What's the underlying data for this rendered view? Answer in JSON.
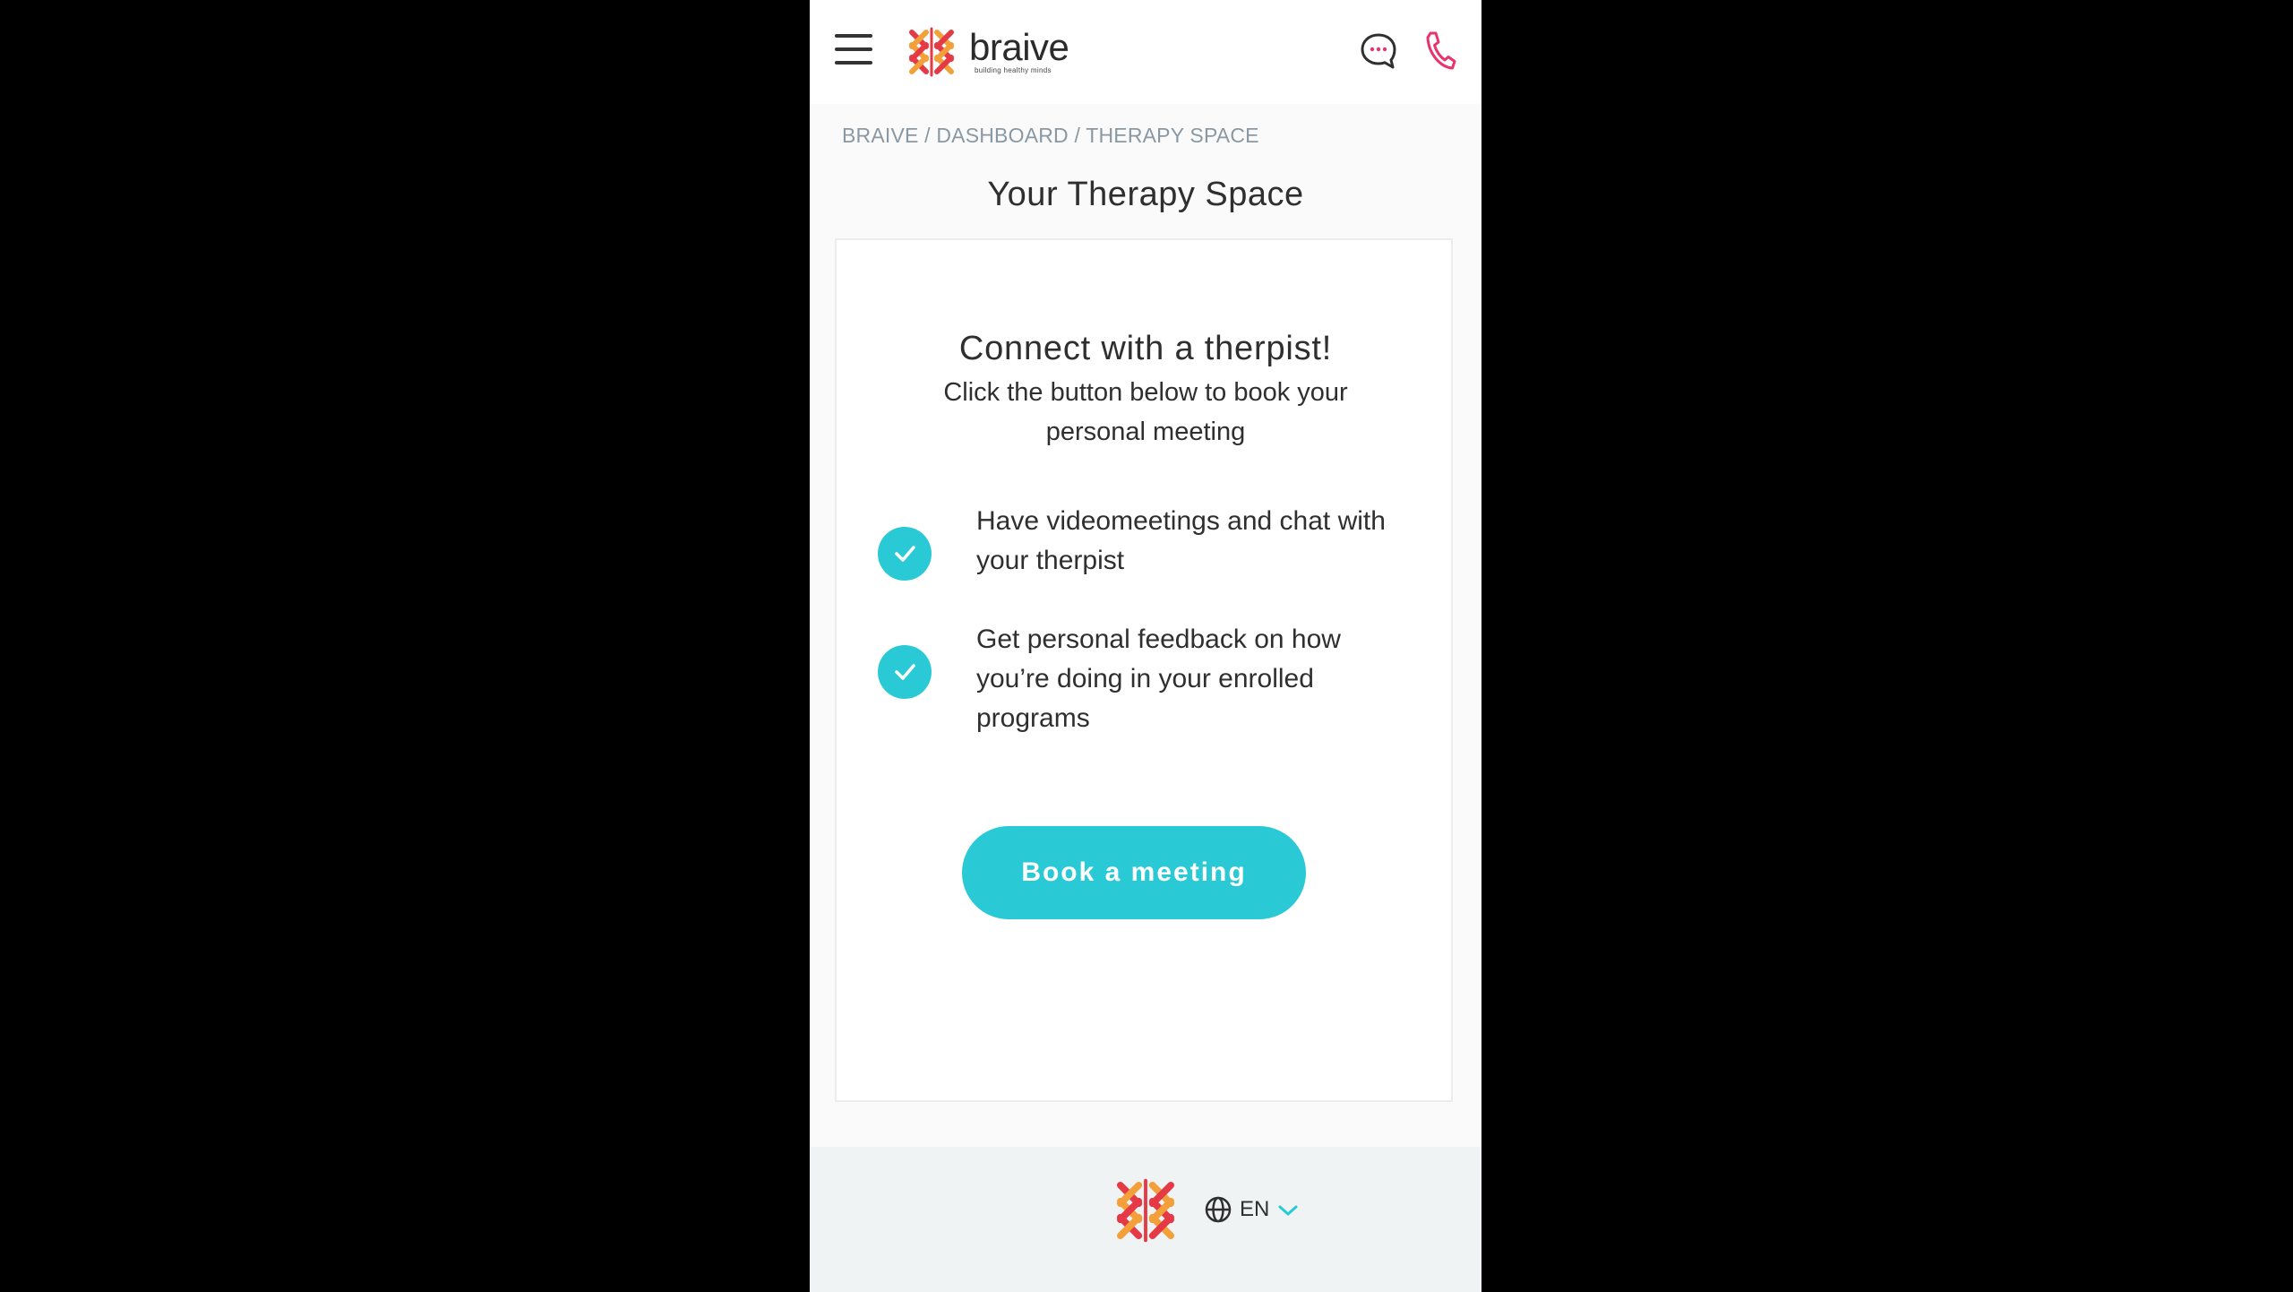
{
  "header": {
    "brand": "braive",
    "tagline": "building healthy minds"
  },
  "breadcrumb": {
    "items": [
      "BRAIVE",
      "DASHBOARD",
      "THERAPY SPACE"
    ],
    "separator": " / "
  },
  "page": {
    "title": "Your Therapy Space"
  },
  "card": {
    "heading": "Connect with a therpist!",
    "subtext": "Click the button below to book your personal meeting",
    "features": [
      "Have videomeetings and chat with your therpist",
      "Get personal feedback on how you’re doing in your enrolled programs"
    ],
    "button_label": "Book a meeting"
  },
  "footer": {
    "language": "EN"
  },
  "icons": {
    "menu": "hamburger-icon",
    "chat": "chat-bubble-icon",
    "call": "phone-icon",
    "check": "check-icon",
    "language": "globe-icon",
    "dropdown": "chevron-down-icon"
  },
  "colors": {
    "accent": "#2ac9d6",
    "phone_icon": "#e8336d",
    "chat_dots": "#e8336d",
    "logo_red": "#e63946",
    "logo_orange": "#f4a03a",
    "footer_bg": "#eff3f4"
  }
}
